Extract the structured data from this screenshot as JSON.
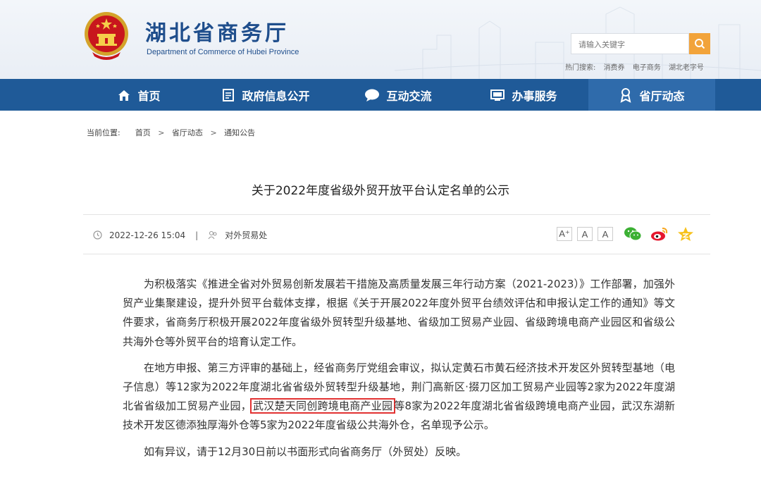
{
  "header": {
    "title": "湖北省商务厅",
    "subtitle": "Department of Commerce of Hubei Province",
    "search_placeholder": "请输入关键字",
    "hot_label": "热门搜索:",
    "hot_items": [
      "消费券",
      "电子商务",
      "湖北老字号"
    ]
  },
  "nav": {
    "items": [
      {
        "label": "首页",
        "icon": "home-icon"
      },
      {
        "label": "政府信息公开",
        "icon": "document-icon"
      },
      {
        "label": "互动交流",
        "icon": "chat-bubble-icon"
      },
      {
        "label": "办事服务",
        "icon": "monitor-icon"
      },
      {
        "label": "省厅动态",
        "icon": "award-icon"
      }
    ],
    "active": "省厅动态"
  },
  "breadcrumb": {
    "label": "当前位置:",
    "items": [
      "首页",
      "省厅动态",
      "通知公告"
    ],
    "separator": ">"
  },
  "article": {
    "title": "关于2022年度省级外贸开放平台认定名单的公示",
    "date": "2022-12-26 15:04",
    "department": "对外贸易处",
    "font_buttons": [
      "A⁺",
      "A",
      "A"
    ],
    "paragraphs": {
      "p1": "为积极落实《推进全省对外贸易创新发展若干措施及高质量发展三年行动方案（2021-2023）》工作部署，加强外贸产业集聚建设，提升外贸平台载体支撑，根据《关于开展2022年度外贸平台绩效评估和申报认定工作的通知》等文件要求，省商务厅积极开展2022年度省级外贸转型升级基地、省级加工贸易产业园、省级跨境电商产业园区和省级公共海外仓等外贸平台的培育认定工作。",
      "p2_before": "在地方申报、第三方评审的基础上，经省商务厅党组会审议，拟认定黄石市黄石经济技术开发区外贸转型基地（电子信息）等12家为2022年度湖北省省级外贸转型升级基地，荆门高新区·掇刀区加工贸易产业园等2家为2022年度湖北省省级加工贸易产业园，",
      "p2_highlight": "武汉楚天同创跨境电商产业园",
      "p2_after": "等8家为2022年度湖北省省级跨境电商产业园，武汉东湖新技术开发区德添独厚海外仓等5家为2022年度省级公共海外仓，名单现予公示。",
      "p3": "如有异议，请于12月30日前以书面形式向省商务厅（外贸处）反映。"
    }
  },
  "colors": {
    "nav_bg": "#1f5a98",
    "brand_blue": "#1f4e8c",
    "search_button": "#f2a33a",
    "highlight_border": "#e23232"
  }
}
